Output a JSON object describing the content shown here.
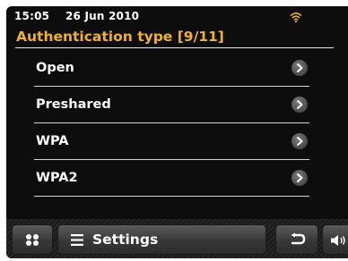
{
  "status": {
    "time": "15:05",
    "date": "26 Jun 2010",
    "wifi_icon": "wifi-icon"
  },
  "header": {
    "title": "Authentication type [9/11]",
    "title_color": "#f2b31b"
  },
  "menu": {
    "items": [
      {
        "label": "Open"
      },
      {
        "label": "Preshared"
      },
      {
        "label": "WPA"
      },
      {
        "label": "WPA2"
      }
    ]
  },
  "bottombar": {
    "home_icon": "grid-icon",
    "settings_label": "Settings",
    "settings_icon": "list-icon",
    "back_icon": "back-arrow-icon",
    "volume_icon": "speaker-icon"
  }
}
